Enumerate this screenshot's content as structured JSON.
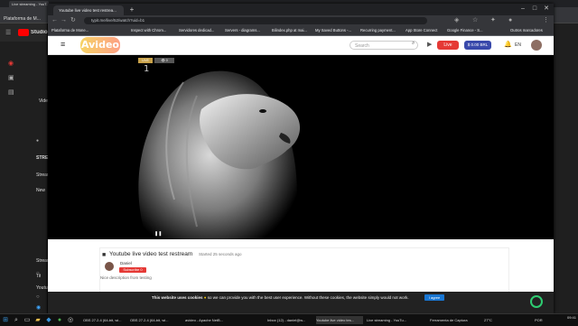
{
  "background_window": {
    "tab_title": "Live streaming - YouT...",
    "app_name": "Studio",
    "bookmark_first": "Plataforma de M...",
    "sidebar_fragments": [
      "Vide",
      "STREA",
      "Stream",
      "New",
      "Stream",
      "Tit",
      "Youtube"
    ]
  },
  "browser": {
    "tab_title": "Youtube live video test restrea...",
    "new_tab": "+",
    "url": "typit.me/live/52/watch?uid=b1",
    "bookmarks": [
      "Plataforma de Mone...",
      "Inspect with Chrom...",
      "Servidores dedicad...",
      "Servers - diagrams...",
      "Bilindex.php at mai...",
      "My Saved Buttons -...",
      "Recurring payment...",
      "App Store Connect",
      "Google Finance - S...",
      "Outros marcadores"
    ]
  },
  "site": {
    "logo": "Avideo",
    "search_placeholder": "Search",
    "live_button": "Live",
    "credits": "$ 0.00 BRL",
    "language": "EN"
  },
  "player": {
    "live_badge": "LIVE",
    "viewers": "0",
    "subtitle_char": "1"
  },
  "video": {
    "title": "Youtube live video test restream",
    "started": "Started 25 seconds ago",
    "channel_name": "Daniel",
    "subscribe_label": "Subscribe",
    "subscribe_count": "0",
    "description": "Nice description from testing"
  },
  "cookie_banner": {
    "bold": "This website uses cookies",
    "text": "so we can provide you with the best user experience. Without these cookies, the website simply would not work.",
    "button": "I agree"
  },
  "taskbar": {
    "items": [
      "OBS 27.2.4 (64-bit, wi...",
      "OBS 27.2.4 (64-bit, wi...",
      "avideo - Apache NetB...",
      "Inbox (12) - daniel@w...",
      "Youtube live video tes...",
      "Live streaming - YouTu...",
      "Ferramenta de Captura"
    ],
    "temperature": "27°C",
    "language": "POR",
    "time": "09:41"
  }
}
